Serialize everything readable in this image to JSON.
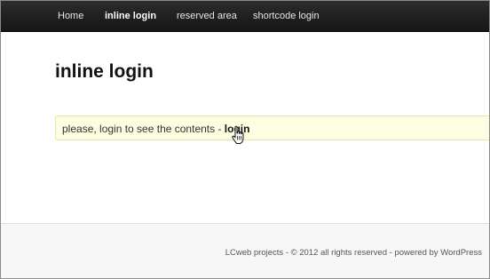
{
  "nav": {
    "items": [
      {
        "label": "Home"
      },
      {
        "label": "inline login",
        "active": true
      },
      {
        "label": "reserved area"
      },
      {
        "label": "shortcode login"
      }
    ]
  },
  "main": {
    "title": "inline login",
    "notice": {
      "text": "please, login to see the contents - ",
      "link_label": "login"
    }
  },
  "footer": {
    "text": "LCweb projects - © 2012 all rights reserved - powered by WordPress"
  },
  "colors": {
    "nav_background": "#1e1e1e",
    "notice_background": "#fdfde2",
    "notice_border": "#e8e3a8",
    "footer_background": "#f7f7f7"
  },
  "icons": {
    "cursor": "hand-pointer-icon"
  }
}
